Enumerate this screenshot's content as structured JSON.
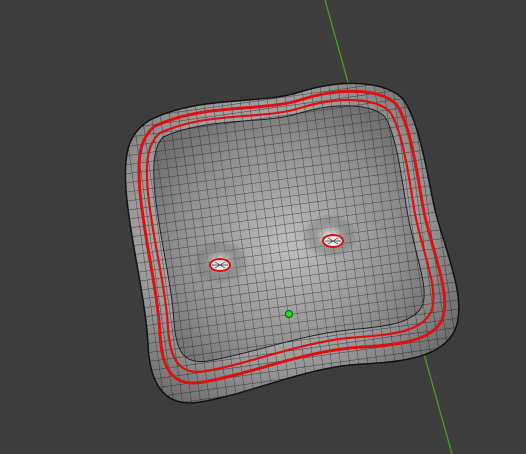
{
  "viewport": {
    "background_color": "#3d3d3d",
    "mesh_edge_color": "#111111",
    "mesh_surface_color": "#9a9a9a",
    "selected_edge_color": "#e01010",
    "y_axis_color": "#4a9a2a",
    "origin_color": "#22dd22"
  }
}
